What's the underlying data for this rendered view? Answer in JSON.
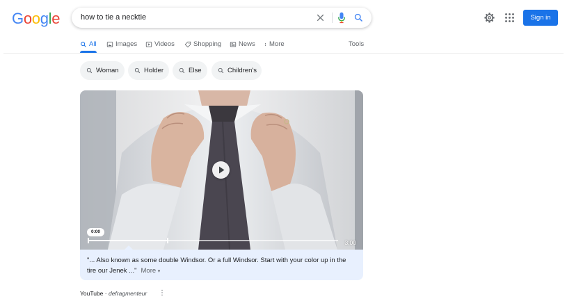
{
  "logo": {
    "letters": [
      "G",
      "o",
      "o",
      "g",
      "l",
      "e"
    ],
    "colors": [
      "#4285F4",
      "#EA4335",
      "#FBBC05",
      "#4285F4",
      "#34A853",
      "#EA4335"
    ]
  },
  "search": {
    "query": "how to tie a necktie",
    "icons": [
      "close-icon",
      "mic-icon",
      "search-icon"
    ]
  },
  "header": {
    "settings_icon": "gear-icon",
    "apps_icon": "apps-grid-icon",
    "signin_label": "Sign in",
    "accent": "#1a73e8"
  },
  "tabs": [
    {
      "label": "All",
      "icon": "search-icon",
      "active": true
    },
    {
      "label": "Images",
      "icon": "image-icon"
    },
    {
      "label": "Videos",
      "icon": "video-icon"
    },
    {
      "label": "Shopping",
      "icon": "tag-icon"
    },
    {
      "label": "News",
      "icon": "news-icon"
    },
    {
      "label": "More",
      "icon": "more-vertical-icon"
    },
    {
      "label": "Tools"
    }
  ],
  "chips": [
    {
      "label": "Woman"
    },
    {
      "label": "Holder"
    },
    {
      "label": "Else"
    },
    {
      "label": "Children's"
    }
  ],
  "video": {
    "current_time": "0:00",
    "duration": "3:00",
    "progress_fraction": 0.32
  },
  "caption": {
    "text": "\"... Also known as some double Windsor. Or a full Windsor. Start with your color up in the tire our Jenek ...\"",
    "more_label": "More"
  },
  "source": {
    "site": "YouTube",
    "separator": " · ",
    "author": "defragmenteur"
  }
}
